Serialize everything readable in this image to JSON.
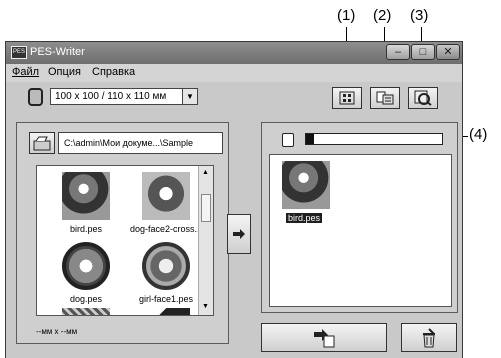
{
  "callouts": {
    "c1": "(1)",
    "c2": "(2)",
    "c3": "(3)",
    "c4": "(4)"
  },
  "window": {
    "app_icon_text": "PES",
    "title": "PES-Writer",
    "btn_min": "–",
    "btn_max": "□",
    "btn_close": "✕"
  },
  "menu": [
    "Файл",
    "Опция",
    "Справка"
  ],
  "hoop": {
    "selected": "100 x 100 / 110 x 110 мм"
  },
  "source": {
    "path": "C:\\admin\\Мои докуме...\\Sample",
    "files": [
      "bird.pes",
      "dog-face2-cross...",
      "dog.pes",
      "girl-face1.pes"
    ],
    "size_label": "--мм x --мм"
  },
  "card": {
    "files": [
      "bird.pes"
    ],
    "capacity_fill": 0.06
  },
  "colors": {
    "window_frame": "#6e6e6e",
    "panel": "#cfcfcf",
    "selection": "#1f1f1f"
  }
}
